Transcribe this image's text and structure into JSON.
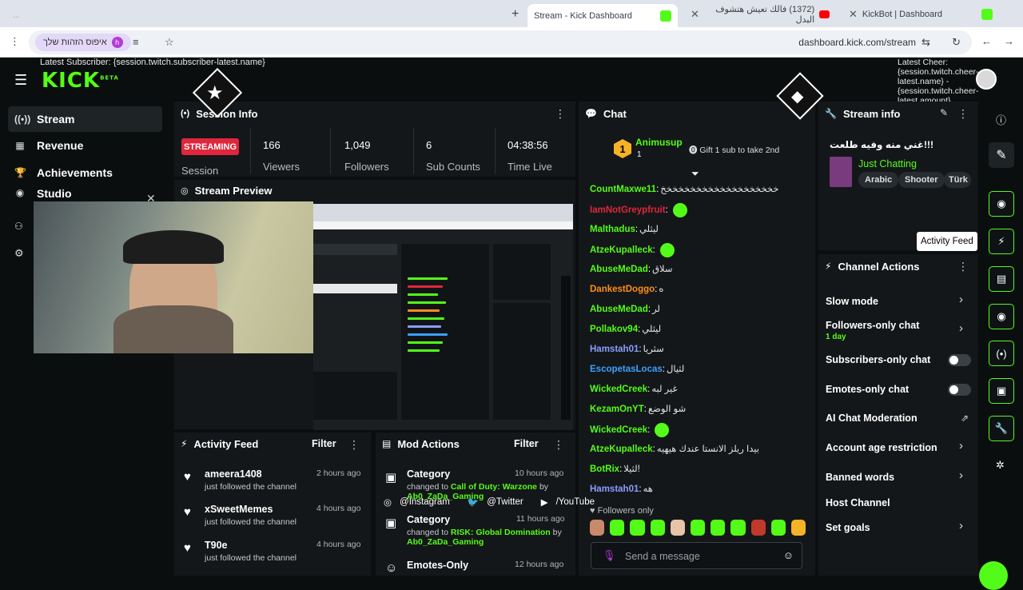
{
  "browser": {
    "tabs": [
      {
        "label": "Stream - Kick Dashboard",
        "active": true
      },
      {
        "label": "(1372) فالك تعيش هتشوف البدل",
        "active": false
      },
      {
        "label": "KickBot | Dashboard",
        "active": false
      }
    ],
    "overlay_top_text": "...",
    "address": "dashboard.kick.com/stream",
    "profile_chip": "איפוס הזהות שלך",
    "profile_initial": "h"
  },
  "overlay": {
    "latest_subscriber": "Latest Subscriber: {session.twitch.subscriber-latest.name}",
    "latest_cheer": "Latest Cheer: {session.twitch.cheer-latest.name} - {session.twitch.cheer-latest.amount}",
    "socials": [
      "@Instagram",
      "@Twitter",
      "/YouTube"
    ]
  },
  "sidebar": {
    "logo": "KICK",
    "logo_badge": "BETA",
    "items": [
      {
        "label": "Stream",
        "icon": "broadcast-icon",
        "active": true
      },
      {
        "label": "Revenue",
        "icon": "chart-icon",
        "active": false
      },
      {
        "label": "Achievements",
        "icon": "trophy-icon",
        "active": false
      },
      {
        "label": "Studio",
        "icon": "camera-icon",
        "active": false
      },
      {
        "label": "",
        "icon": "users-icon",
        "active": false
      },
      {
        "label": "",
        "icon": "gear-icon",
        "active": false
      }
    ]
  },
  "session_info": {
    "title": "Session Info",
    "badge": "STREAMING",
    "session_label": "Session",
    "stats": [
      {
        "value": "166",
        "label": "Viewers"
      },
      {
        "value": "1,049",
        "label": "Followers"
      },
      {
        "value": "6",
        "label": "Sub Counts"
      },
      {
        "value": "04:38:56",
        "label": "Time Live"
      }
    ]
  },
  "stream_preview": {
    "title": "Stream Preview"
  },
  "chat": {
    "title": "Chat",
    "pinned_user": "Animusup",
    "pinned_rank": "1",
    "pinned_count": "1",
    "gift_text": "Gift 1 sub to take 2nd",
    "messages": [
      {
        "user": "CountMaxwe11",
        "color": "#53fc18",
        "text": "خخخخخخخخخخخخخخخخخخخخ",
        "emote": false
      },
      {
        "user": "IamNotGreypfruit",
        "color": "#e0263c",
        "text": "",
        "emote": true
      },
      {
        "user": "Malthadus",
        "color": "#53fc18",
        "text": "ليثلي",
        "emote": false
      },
      {
        "user": "AtzeKupalleck",
        "color": "#53fc18",
        "text": "",
        "emote": true
      },
      {
        "user": "AbuseMeDad",
        "color": "#53fc18",
        "text": "سلاق",
        "emote": false
      },
      {
        "user": "DankestDoggo",
        "color": "#ff8c1a",
        "text": "ه",
        "emote": false
      },
      {
        "user": "AbuseMeDad",
        "color": "#53fc18",
        "text": "لر",
        "emote": false
      },
      {
        "user": "Pollakov94",
        "color": "#53fc18",
        "text": "ليثلي",
        "emote": false
      },
      {
        "user": "Hamstah01",
        "color": "#8a9cff",
        "text": "سثريا",
        "emote": false
      },
      {
        "user": "EscopetasLocas",
        "color": "#3aa0ff",
        "text": "لثيال",
        "emote": false
      },
      {
        "user": "WickedCreek",
        "color": "#53fc18",
        "text": "غير لبه",
        "emote": false
      },
      {
        "user": "KezamOnYT",
        "color": "#53fc18",
        "text": "شو الوضع",
        "emote": false
      },
      {
        "user": "WickedCreek",
        "color": "#53fc18",
        "text": "",
        "emote": true
      },
      {
        "user": "AtzeKupalleck",
        "color": "#53fc18",
        "text": "بيدا ريلز الانستا عندك هيهيه",
        "emote": false
      },
      {
        "user": "BotRix",
        "color": "#53fc18",
        "text": "لثيلا!",
        "emote": false
      },
      {
        "user": "Hamstah01",
        "color": "#8a9cff",
        "text": "هه",
        "emote": false
      }
    ],
    "followers_only": "Followers only",
    "input_placeholder": "Send a message"
  },
  "stream_info": {
    "title": "Stream info",
    "stream_title": "!!!غني منه وفيه طلعت",
    "category": "Just Chatting",
    "tags": [
      "Arabic",
      "Shooter",
      "Türk"
    ],
    "tooltip": "Activity Feed"
  },
  "channel_actions": {
    "title": "Channel Actions",
    "rows": [
      {
        "label": "Slow mode",
        "control": "arrow"
      },
      {
        "label": "Followers-only chat",
        "sub": "1 day",
        "control": "arrow"
      },
      {
        "label": "Subscribers-only chat",
        "control": "toggle"
      },
      {
        "label": "Emotes-only chat",
        "control": "toggle"
      },
      {
        "label": "AI Chat Moderation",
        "control": "external"
      },
      {
        "label": "Account age restriction",
        "control": "arrow"
      },
      {
        "label": "Banned words",
        "control": "arrow"
      },
      {
        "label": "Host Channel",
        "control": "none"
      },
      {
        "label": "Set goals",
        "control": "arrow"
      }
    ]
  },
  "activity_feed": {
    "title": "Activity Feed",
    "filter": "Filter",
    "items": [
      {
        "name": "ameera1408",
        "text": "just followed the channel",
        "time": "2 hours ago"
      },
      {
        "name": "xSweetMemes",
        "text": "just followed the channel",
        "time": "4 hours ago"
      },
      {
        "name": "T90e",
        "text": "just followed the channel",
        "time": "4 hours ago"
      }
    ]
  },
  "mod_actions": {
    "title": "Mod Actions",
    "filter": "Filter",
    "items": [
      {
        "title": "Category",
        "prefix": "changed to",
        "highlight": "Call of Duty: Warzone",
        "by": "by",
        "user": "Ab0_ZaDa_Gaming",
        "time": "10 hours ago"
      },
      {
        "title": "Category",
        "prefix": "changed to",
        "highlight": "RISK: Global Domination",
        "by": "by",
        "user": "Ab0_ZaDa_Gaming",
        "time": "11 hours ago"
      },
      {
        "title": "Emotes-Only",
        "prefix": "",
        "highlight": "",
        "by": "",
        "user": "",
        "time": "12 hours ago"
      }
    ]
  }
}
